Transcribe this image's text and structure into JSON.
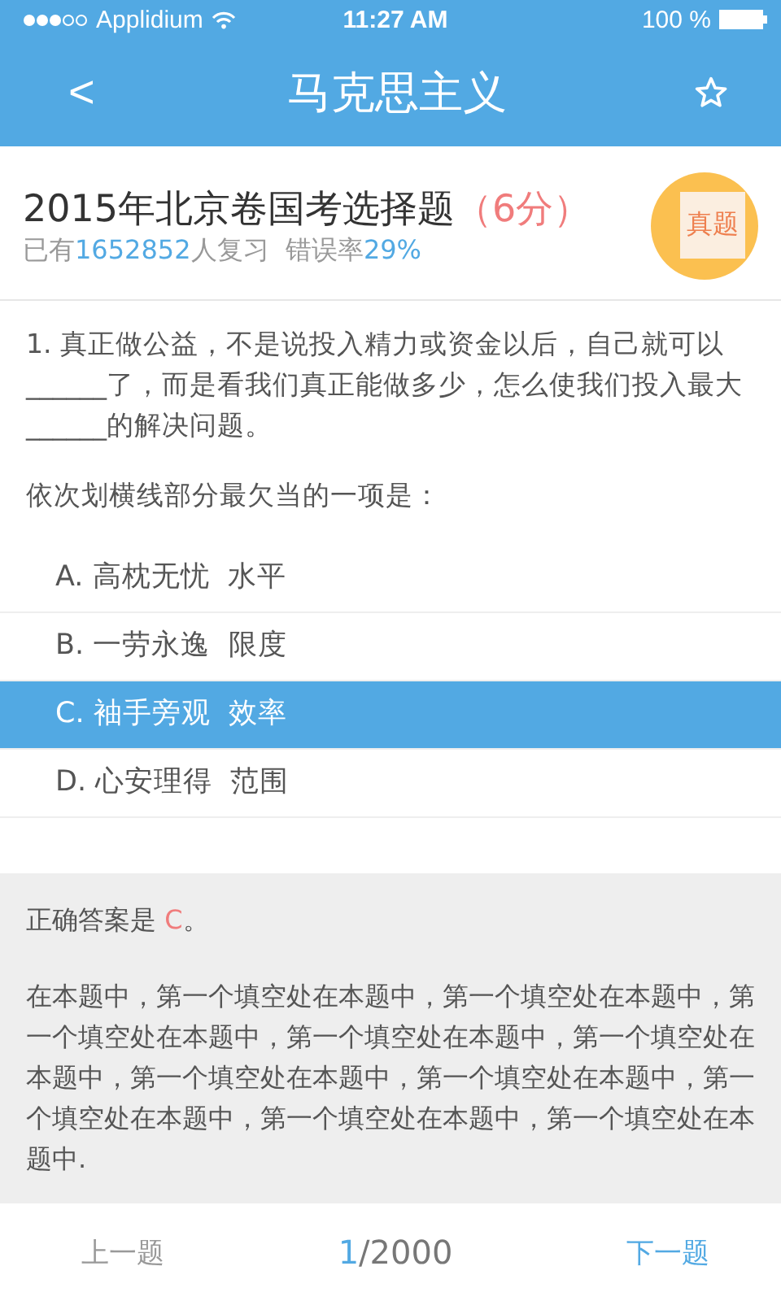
{
  "status_bar": {
    "carrier": "Applidium",
    "time": "11:27 AM",
    "battery": "100 %"
  },
  "nav": {
    "back": "<",
    "title": "马克思主义"
  },
  "header": {
    "title": [
      {
        "text": "2015年北京卷国考选择题",
        "kind": "plain"
      },
      {
        "text": "（6分）",
        "kind": "score"
      }
    ],
    "stats": [
      {
        "text": "已有",
        "kind": "plain"
      },
      {
        "text": "1652852",
        "kind": "accent"
      },
      {
        "text": "人复习  错误率",
        "kind": "plain"
      },
      {
        "text": "29%",
        "kind": "accent"
      }
    ],
    "badge": "真题"
  },
  "question": {
    "text": "1. 真正做公益，不是说投入精力或资金以后，自己就可以______了，而是看我们真正能做多少，怎么使我们投入最大______的解决问题。",
    "prompt": "依次划横线部分最欠当的一项是："
  },
  "options": [
    {
      "label": "A. 高枕无忧  水平",
      "selected": false
    },
    {
      "label": "B. 一劳永逸  限度",
      "selected": false
    },
    {
      "label": "C. 袖手旁观  效率",
      "selected": true
    },
    {
      "label": "D. 心安理得  范围",
      "selected": false
    }
  ],
  "answer": {
    "line": [
      {
        "text": "正确答案是 ",
        "kind": "plain"
      },
      {
        "text": "C",
        "kind": "score"
      },
      {
        "text": "。",
        "kind": "plain"
      }
    ],
    "explanation": "在本题中，第一个填空处在本题中，第一个填空处在本题中，第一个填空处在本题中，第一个填空处在本题中，第一个填空处在本题中，第一个填空处在本题中，第一个填空处在本题中，第一个填空处在本题中，第一个填空处在本题中，第一个填空处在本题中."
  },
  "footer": {
    "prev": "上一题",
    "current": "1",
    "total": "/2000",
    "next": "下一题"
  }
}
